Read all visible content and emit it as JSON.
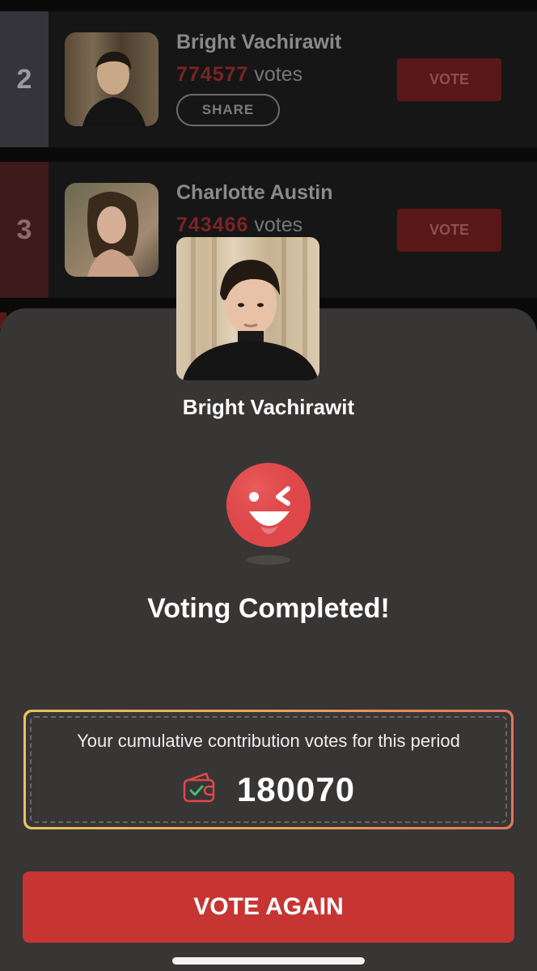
{
  "ranking": [
    {
      "rank": "2",
      "name": "Bright Vachirawit",
      "votes": "774577",
      "votes_unit": "votes",
      "share_label": "SHARE",
      "vote_label": "VOTE"
    },
    {
      "rank": "3",
      "name": "Charlotte Austin",
      "votes": "743466",
      "votes_unit": "votes",
      "vote_label": "VOTE"
    }
  ],
  "modal": {
    "candidate_name": "Bright Vachirawit",
    "title": "Voting Completed!",
    "contribution_label": "Your cumulative contribution votes for this period",
    "contribution_value": "180070",
    "cta_label": "VOTE AGAIN",
    "icons": [
      "winking-face-icon",
      "vote-ticket-icon"
    ]
  },
  "colors": {
    "accent": "#c73533",
    "sheet_bg": "#383535",
    "border_gradient": [
      "#e9c45c",
      "#e0775a"
    ]
  }
}
